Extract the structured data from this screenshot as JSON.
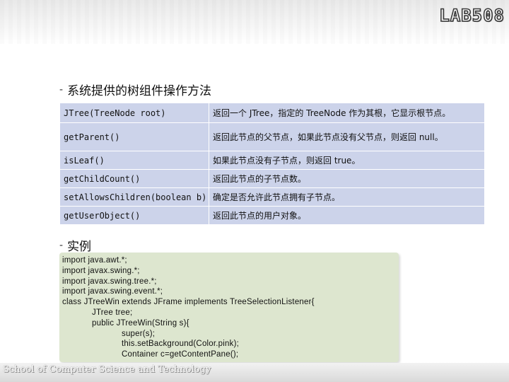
{
  "logo": "LAB508",
  "section1": {
    "bullet": "-",
    "title": "系统提供的树组件操作方法"
  },
  "methods": [
    {
      "method": "JTree(TreeNode root)",
      "desc": "返回一个 JTree，指定的 TreeNode 作为其根，它显示根节点。"
    },
    {
      "method": "getParent()",
      "desc": "返回此节点的父节点，如果此节点没有父节点，则返回 null。"
    },
    {
      "method": "isLeaf()",
      "desc": "如果此节点没有子节点，则返回 true。"
    },
    {
      "method": "getChildCount()",
      "desc": "返回此节点的子节点数。"
    },
    {
      "method": "setAllowsChildren(boolean b)",
      "desc": "确定是否允许此节点拥有子节点。"
    },
    {
      "method": "getUserObject()",
      "desc": "返回此节点的用户对象。"
    }
  ],
  "section2": {
    "bullet": "-",
    "title": "实例"
  },
  "code": [
    "import java.awt.*;",
    "import javax.swing.*;",
    "import javax.swing.tree.*;",
    "import javax.swing.event.*;",
    "class JTreeWin extends JFrame implements TreeSelectionListener{",
    "JTree tree;",
    "public JTreeWin(String s){",
    "super(s);",
    "this.setBackground(Color.pink);",
    "Container c=getContentPane();"
  ],
  "footer": "School of Computer Science and Technology"
}
